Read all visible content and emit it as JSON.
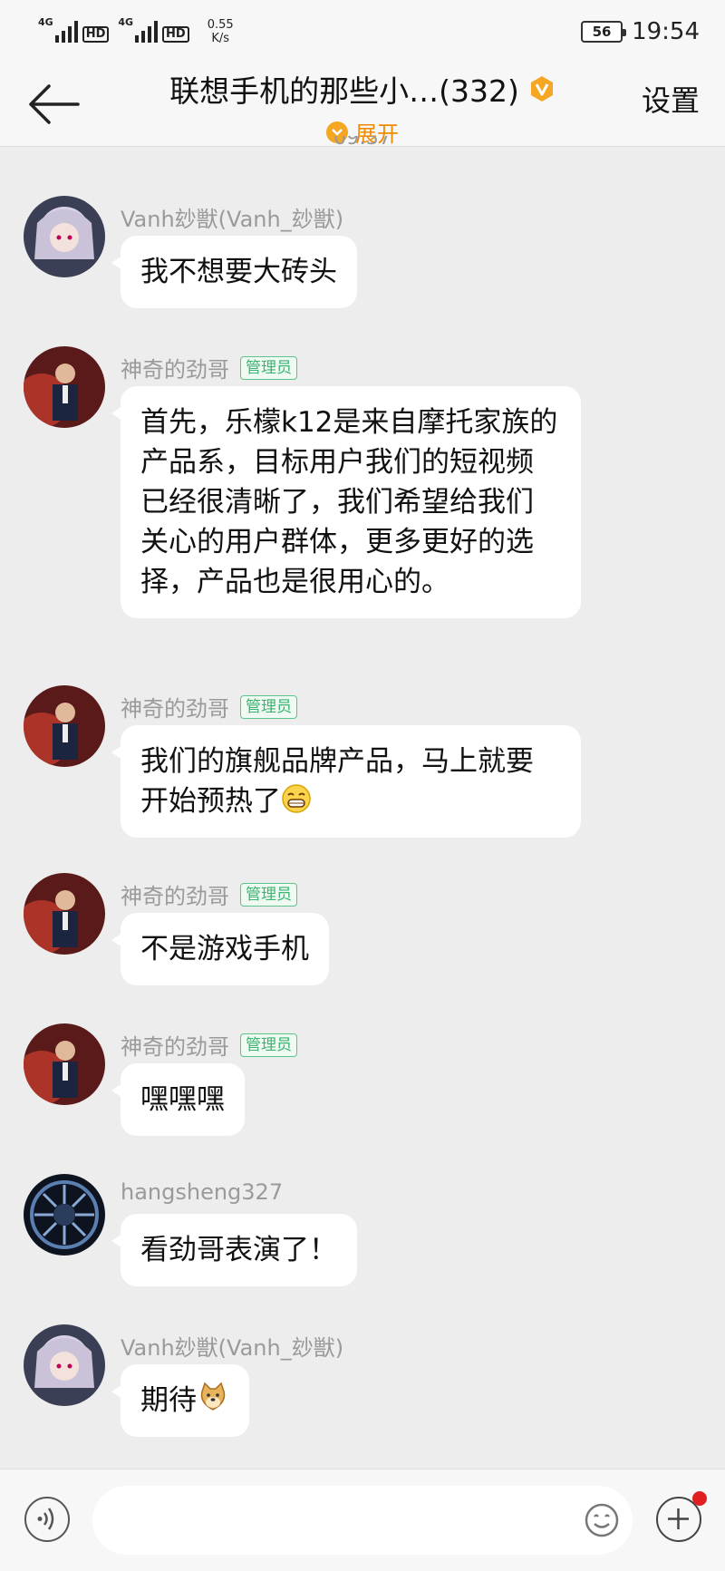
{
  "status_bar": {
    "network1": "4G",
    "network2": "4G",
    "hd_label": "HD",
    "speed_value": "0.55",
    "speed_unit": "K/s",
    "battery": "56",
    "time": "19:54"
  },
  "header": {
    "title": "联想手机的那些小…(332)",
    "expand_label": "展开",
    "settings_label": "设置"
  },
  "timestamp": "09:37",
  "messages": [
    {
      "sender": "Vanh玅獣(Vanh_玅獣)",
      "role": "",
      "text": "我不想要大砖头"
    },
    {
      "sender": "神奇的劲哥",
      "role": "管理员",
      "text": "首先，乐檬k12是来自摩托家族的产品系，目标用户我们的短视频已经很清晰了，我们希望给我们关心的用户群体，更多更好的选择，产品也是很用心的。"
    },
    {
      "sender": "神奇的劲哥",
      "role": "管理员",
      "text": "我们的旗舰品牌产品，马上就要开始预热了"
    },
    {
      "sender": "神奇的劲哥",
      "role": "管理员",
      "text": "不是游戏手机"
    },
    {
      "sender": "神奇的劲哥",
      "role": "管理员",
      "text": "嘿嘿嘿"
    },
    {
      "sender": "hangsheng327",
      "role": "",
      "text": "看劲哥表演了！"
    },
    {
      "sender": "Vanh玅獣(Vanh_玅獣)",
      "role": "",
      "text": "期待"
    }
  ],
  "colors": {
    "accent_orange": "#f5a623",
    "admin_green": "#3cb371",
    "background": "#ededed"
  },
  "icons": [
    "back-arrow-icon",
    "vip-badge-icon",
    "chevron-down-icon",
    "voice-icon",
    "emoji-icon",
    "plus-icon",
    "grin-emoji-icon",
    "doge-emoji-icon"
  ]
}
